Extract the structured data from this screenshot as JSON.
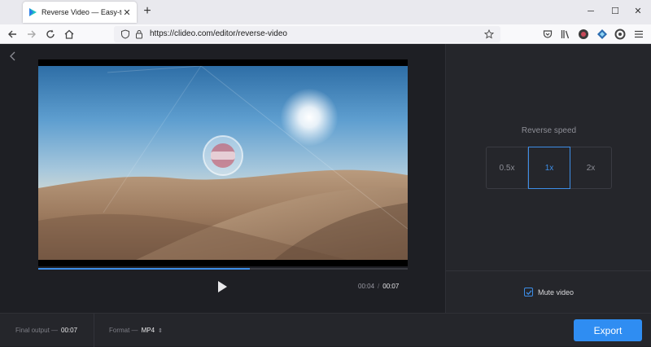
{
  "browser": {
    "tab_title": "Reverse Video — Easy-to-Use O",
    "tab_close": "✕",
    "new_tab": "+",
    "url": "https://clideo.com/editor/reverse-video",
    "window": {
      "minimize": "─",
      "maximize": "☐",
      "close": "✕"
    }
  },
  "player": {
    "current_time": "00:04",
    "separator": "/",
    "duration": "00:07",
    "progress_fraction": 0.573
  },
  "settings": {
    "speed_label": "Reverse speed",
    "speeds": [
      "0.5x",
      "1x",
      "2x"
    ],
    "selected_speed": "1x",
    "mute_label": "Mute video",
    "mute_checked": true
  },
  "bottom": {
    "final_output_label": "Final output —",
    "final_output_value": "00:07",
    "format_label": "Format —",
    "format_value": "MP4",
    "export_label": "Export"
  },
  "colors": {
    "accent": "#2f8df2",
    "background": "#1e1f24",
    "panel": "#25262b"
  }
}
